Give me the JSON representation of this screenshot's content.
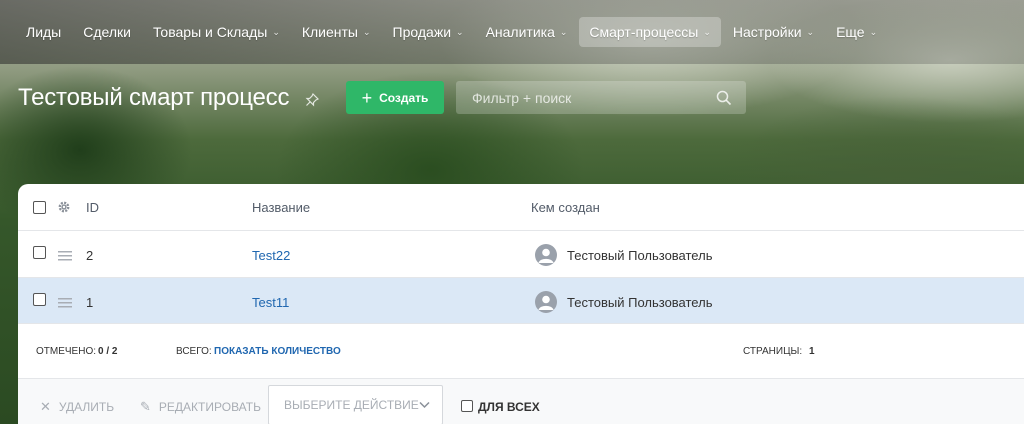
{
  "nav": {
    "items": [
      {
        "label": "Лиды",
        "has_menu": false,
        "active": false
      },
      {
        "label": "Сделки",
        "has_menu": false,
        "active": false
      },
      {
        "label": "Товары и Склады",
        "has_menu": true,
        "active": false
      },
      {
        "label": "Клиенты",
        "has_menu": true,
        "active": false
      },
      {
        "label": "Продажи",
        "has_menu": true,
        "active": false
      },
      {
        "label": "Аналитика",
        "has_menu": true,
        "active": false
      },
      {
        "label": "Смарт-процессы",
        "has_menu": true,
        "active": true
      },
      {
        "label": "Настройки",
        "has_menu": true,
        "active": false
      },
      {
        "label": "Еще",
        "has_menu": true,
        "active": false
      }
    ]
  },
  "header": {
    "title": "Тестовый смарт процесс",
    "create_label": "Создать",
    "search_placeholder": "Фильтр + поиск"
  },
  "grid": {
    "columns": {
      "id": "ID",
      "name": "Название",
      "author": "Кем создан"
    },
    "rows": [
      {
        "id": "2",
        "name": "Test22",
        "author": "Тестовый Пользователь",
        "selected": false
      },
      {
        "id": "1",
        "name": "Test11",
        "author": "Тестовый Пользователь",
        "selected": false
      }
    ]
  },
  "footer": {
    "checked_label": "Отмечено:",
    "checked_value": "0 / 2",
    "total_label": "Всего:",
    "total_link": "Показать количество",
    "pages_label": "Страницы:",
    "pages_value": "1"
  },
  "actions": {
    "delete_label": "Удалить",
    "edit_label": "Редактировать",
    "select_placeholder": "Выберите действие",
    "for_all_label": "Для всех"
  },
  "colors": {
    "accent_green": "#2fb768",
    "link_blue": "#2067b0",
    "selected_row": "#dbe8f6"
  }
}
